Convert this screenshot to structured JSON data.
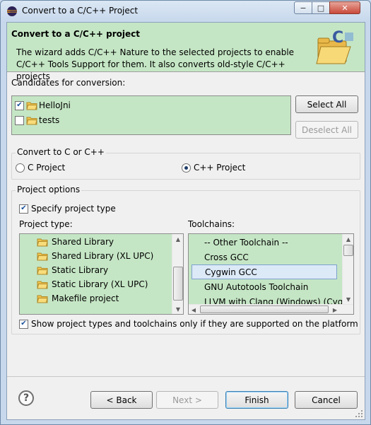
{
  "window": {
    "title": "Convert to a C/C++ Project",
    "controls": {
      "minimize": "−",
      "maximize": "□",
      "close": "✕"
    }
  },
  "banner": {
    "title": "Convert to a C/C++ project",
    "description": "The wizard adds C/C++ Nature to the selected projects to enable C/C++ Tools Support for them. It also converts old-style C/C++ projects",
    "icon": "cpp-project-folder-icon"
  },
  "candidates": {
    "label": "Candidates for conversion:",
    "items": [
      {
        "name": "HelloJni",
        "checked": true
      },
      {
        "name": "tests",
        "checked": false
      }
    ],
    "select_all": "Select All",
    "deselect_all": "Deselect All"
  },
  "convert_to": {
    "label": "Convert to C or C++",
    "options": [
      {
        "label": "C Project",
        "selected": false
      },
      {
        "label": "C++ Project",
        "selected": true
      }
    ]
  },
  "project_options": {
    "label": "Project options",
    "specify_type": {
      "label": "Specify project type",
      "checked": true
    },
    "project_type_label": "Project type:",
    "project_types": [
      "Shared Library",
      "Shared Library (XL UPC)",
      "Static Library",
      "Static Library (XL UPC)",
      "Makefile project"
    ],
    "toolchains_label": "Toolchains:",
    "toolchains": [
      "-- Other Toolchain --",
      "Cross GCC",
      "Cygwin GCC",
      "GNU Autotools Toolchain",
      "LLVM with Clang (Windows) (Cyg"
    ],
    "selected_toolchain": "Cygwin GCC",
    "filter": {
      "label": "Show project types and toolchains only if they are supported on the platform",
      "checked": true
    }
  },
  "footer": {
    "help": "?",
    "back": "< Back",
    "next": "Next >",
    "finish": "Finish",
    "cancel": "Cancel"
  },
  "colors": {
    "banner_bg": "#c5e6c5",
    "list_bg": "#c5e6c5",
    "dialog_bg": "#f0f0f0",
    "title_bg": "#c7d8ec"
  }
}
